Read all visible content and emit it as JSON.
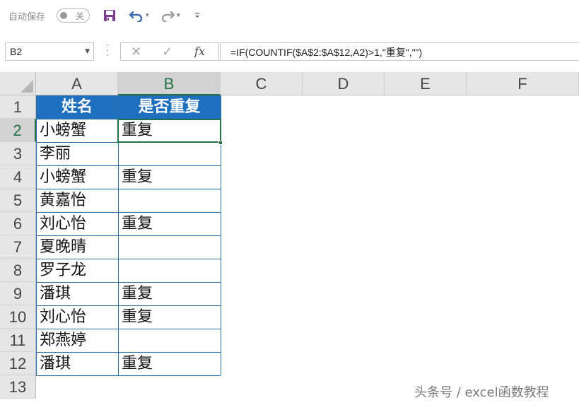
{
  "toolbar": {
    "autosave_label": "自动保存",
    "autosave_state": "关"
  },
  "formula_bar": {
    "name_box": "B2",
    "fx_label": "fx",
    "cancel_glyph": "✕",
    "enter_glyph": "✓",
    "formula": "=IF(COUNTIF($A$2:$A$12,A2)>1,\"重复\",\"\")"
  },
  "columns": [
    "A",
    "B",
    "C",
    "D",
    "E",
    "F"
  ],
  "rows": [
    "1",
    "2",
    "3",
    "4",
    "5",
    "6",
    "7",
    "8",
    "9",
    "10",
    "11",
    "12",
    "13"
  ],
  "selected_cell": "B2",
  "table": {
    "headers": [
      "姓名",
      "是否重复"
    ],
    "data": [
      [
        "小螃蟹",
        "重复"
      ],
      [
        "李丽",
        ""
      ],
      [
        "小螃蟹",
        "重复"
      ],
      [
        "黄嘉怡",
        ""
      ],
      [
        "刘心怡",
        "重复"
      ],
      [
        "夏晚晴",
        ""
      ],
      [
        "罗子龙",
        ""
      ],
      [
        "潘琪",
        "重复"
      ],
      [
        "刘心怡",
        "重复"
      ],
      [
        "郑燕婷",
        ""
      ],
      [
        "潘琪",
        "重复"
      ]
    ]
  },
  "watermark": "头条号 / excel函数教程",
  "colors": {
    "header_fill": "#1f6fbf",
    "selection": "#217346",
    "table_border": "#2e6da4"
  }
}
